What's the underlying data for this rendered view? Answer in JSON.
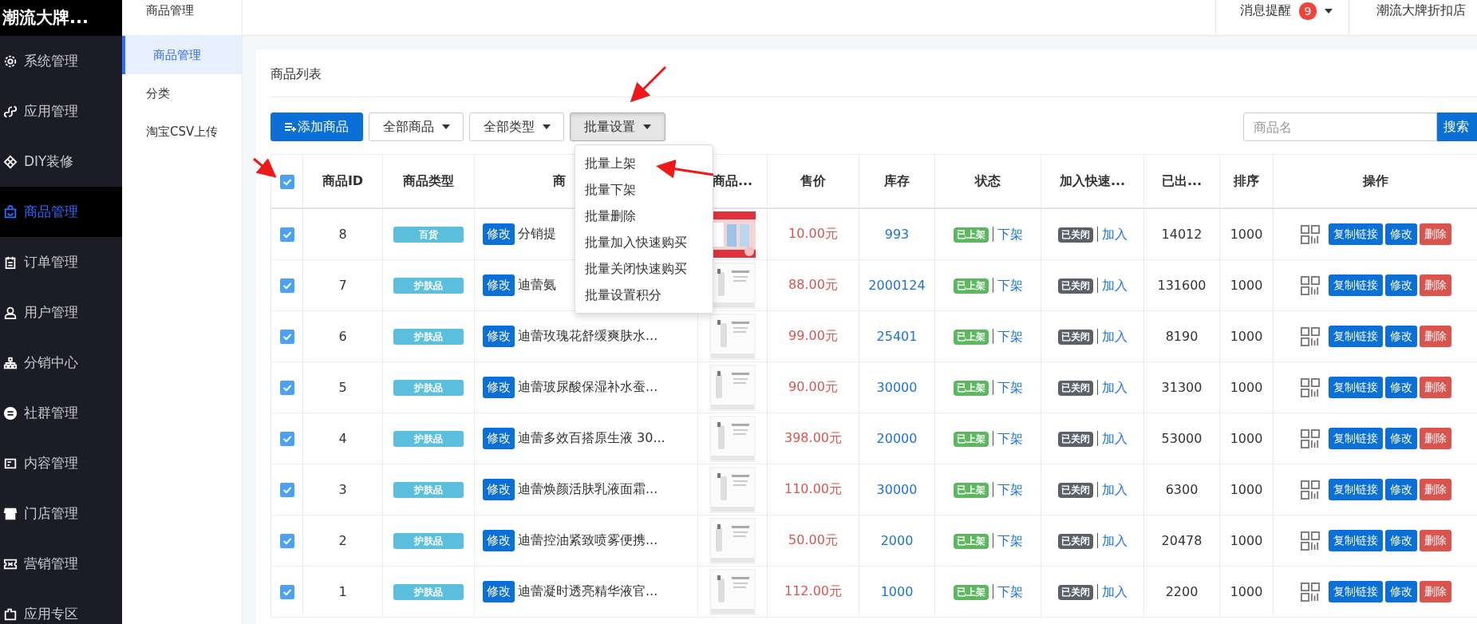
{
  "sidebar": {
    "logo": "潮流大牌...",
    "items": [
      {
        "label": "系统管理",
        "selected": false
      },
      {
        "label": "应用管理",
        "selected": false
      },
      {
        "label": "DIY装修",
        "selected": false
      },
      {
        "label": "商品管理",
        "selected": true
      },
      {
        "label": "订单管理",
        "selected": false
      },
      {
        "label": "用户管理",
        "selected": false
      },
      {
        "label": "分销中心",
        "selected": false
      },
      {
        "label": "社群管理",
        "selected": false
      },
      {
        "label": "内容管理",
        "selected": false
      },
      {
        "label": "门店管理",
        "selected": false
      },
      {
        "label": "营销管理",
        "selected": false
      },
      {
        "label": "应用专区",
        "selected": false
      }
    ]
  },
  "subnav": {
    "title": "商品管理",
    "items": [
      {
        "label": "商品管理",
        "selected": true
      },
      {
        "label": "分类",
        "selected": false
      },
      {
        "label": "淘宝CSV上传",
        "selected": false
      }
    ]
  },
  "header": {
    "notifications": {
      "label": "消息提醒",
      "count": "9"
    },
    "shop": "潮流大牌折扣店"
  },
  "card": {
    "title": "商品列表",
    "toolbar": {
      "add_button": "添加商品",
      "filters": [
        "全部商品",
        "全部类型"
      ],
      "batch_button": "批量设置",
      "search": {
        "placeholder": "商品名",
        "button": "搜索"
      }
    },
    "batch_menu": {
      "open": true,
      "items": [
        "批量上架",
        "批量下架",
        "批量删除",
        "批量加入快速购买",
        "批量关闭快速购买",
        "批量设置积分"
      ]
    }
  },
  "table": {
    "all_checked": true,
    "columns": [
      "商品ID",
      "商品类型",
      "商",
      "商品...",
      "售价",
      "库存",
      "状态",
      "加入快速...",
      "已出...",
      "排序",
      "操作"
    ],
    "rows": [
      {
        "checked": true,
        "id": "8",
        "type": "百货",
        "edit": "修改",
        "name": "分销提",
        "price": "10.00元",
        "stock": "993",
        "status": {
          "label": "已上架",
          "kind": "on"
        },
        "status_link": "下架",
        "quick": {
          "label": "已关闭",
          "kind": "off"
        },
        "quick_link": "加入",
        "sold": "14012",
        "sort": "1000",
        "actions": [
          {
            "label": "复制链接",
            "kind": "primary"
          },
          {
            "label": "修改",
            "kind": "primary"
          },
          {
            "label": "删除",
            "kind": "danger"
          }
        ]
      },
      {
        "checked": true,
        "id": "7",
        "type": "护肤品",
        "edit": "修改",
        "name": "迪蕾氨",
        "price": "88.00元",
        "stock": "2000124",
        "status": {
          "label": "已上架",
          "kind": "on"
        },
        "status_link": "下架",
        "quick": {
          "label": "已关闭",
          "kind": "off"
        },
        "quick_link": "加入",
        "sold": "131600",
        "sort": "1000",
        "actions": [
          {
            "label": "复制链接",
            "kind": "primary"
          },
          {
            "label": "修改",
            "kind": "primary"
          },
          {
            "label": "删除",
            "kind": "danger"
          }
        ]
      },
      {
        "checked": true,
        "id": "6",
        "type": "护肤品",
        "edit": "修改",
        "name": "迪蕾玫瑰花舒缓爽肤水...",
        "price": "99.00元",
        "stock": "25401",
        "status": {
          "label": "已上架",
          "kind": "on"
        },
        "status_link": "下架",
        "quick": {
          "label": "已关闭",
          "kind": "off"
        },
        "quick_link": "加入",
        "sold": "8190",
        "sort": "1000",
        "actions": [
          {
            "label": "复制链接",
            "kind": "primary"
          },
          {
            "label": "修改",
            "kind": "primary"
          },
          {
            "label": "删除",
            "kind": "danger"
          }
        ]
      },
      {
        "checked": true,
        "id": "5",
        "type": "护肤品",
        "edit": "修改",
        "name": "迪蕾玻尿酸保湿补水蚕...",
        "price": "90.00元",
        "stock": "30000",
        "status": {
          "label": "已上架",
          "kind": "on"
        },
        "status_link": "下架",
        "quick": {
          "label": "已关闭",
          "kind": "off"
        },
        "quick_link": "加入",
        "sold": "31300",
        "sort": "1000",
        "actions": [
          {
            "label": "复制链接",
            "kind": "primary"
          },
          {
            "label": "修改",
            "kind": "primary"
          },
          {
            "label": "删除",
            "kind": "danger"
          }
        ]
      },
      {
        "checked": true,
        "id": "4",
        "type": "护肤品",
        "edit": "修改",
        "name": "迪蕾多效百搭原生液 30...",
        "price": "398.00元",
        "stock": "20000",
        "status": {
          "label": "已上架",
          "kind": "on"
        },
        "status_link": "下架",
        "quick": {
          "label": "已关闭",
          "kind": "off"
        },
        "quick_link": "加入",
        "sold": "53000",
        "sort": "1000",
        "actions": [
          {
            "label": "复制链接",
            "kind": "primary"
          },
          {
            "label": "修改",
            "kind": "primary"
          },
          {
            "label": "删除",
            "kind": "danger"
          }
        ]
      },
      {
        "checked": true,
        "id": "3",
        "type": "护肤品",
        "edit": "修改",
        "name": "迪蕾焕颜活肤乳液面霜...",
        "price": "110.00元",
        "stock": "30000",
        "status": {
          "label": "已上架",
          "kind": "on"
        },
        "status_link": "下架",
        "quick": {
          "label": "已关闭",
          "kind": "off"
        },
        "quick_link": "加入",
        "sold": "6300",
        "sort": "1000",
        "actions": [
          {
            "label": "复制链接",
            "kind": "primary"
          },
          {
            "label": "修改",
            "kind": "primary"
          },
          {
            "label": "删除",
            "kind": "danger"
          }
        ]
      },
      {
        "checked": true,
        "id": "2",
        "type": "护肤品",
        "edit": "修改",
        "name": "迪蕾控油紧致喷雾便携...",
        "price": "50.00元",
        "stock": "2000",
        "status": {
          "label": "已上架",
          "kind": "on"
        },
        "status_link": "下架",
        "quick": {
          "label": "已关闭",
          "kind": "off"
        },
        "quick_link": "加入",
        "sold": "20478",
        "sort": "1000",
        "actions": [
          {
            "label": "复制链接",
            "kind": "primary"
          },
          {
            "label": "修改",
            "kind": "primary"
          },
          {
            "label": "删除",
            "kind": "danger"
          }
        ]
      },
      {
        "checked": true,
        "id": "1",
        "type": "护肤品",
        "edit": "修改",
        "name": "迪蕾凝时透亮精华液官...",
        "price": "112.00元",
        "stock": "1000",
        "status": {
          "label": "已上架",
          "kind": "on"
        },
        "status_link": "下架",
        "quick": {
          "label": "已关闭",
          "kind": "off"
        },
        "quick_link": "加入",
        "sold": "2200",
        "sort": "1000",
        "actions": [
          {
            "label": "复制链接",
            "kind": "primary"
          },
          {
            "label": "修改",
            "kind": "primary"
          },
          {
            "label": "删除",
            "kind": "danger"
          }
        ]
      }
    ]
  }
}
